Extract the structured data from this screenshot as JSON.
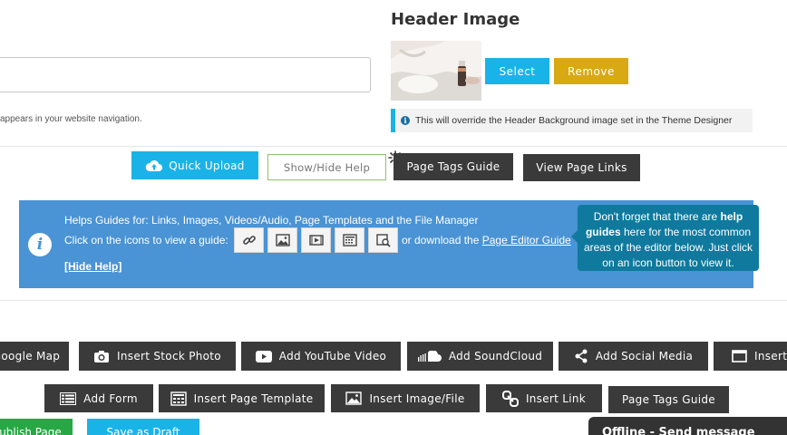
{
  "page_name": {
    "hint": "appears in your website navigation.",
    "input_value": ""
  },
  "header_image": {
    "title": "Header Image",
    "select_label": "Select",
    "remove_label": "Remove",
    "note": "This will override the Header Background image set in the Theme Designer"
  },
  "toolbar": {
    "quick_upload": "Quick Upload",
    "show_hide_help": "Show/Hide Help",
    "page_tags_guide": "Page Tags Guide",
    "view_page_links": "View Page Links"
  },
  "help": {
    "line1": "Helps Guides for: Links, Images, Videos/Audio, Page Templates and the File Manager",
    "line2": "Click on the icons to view a guide:",
    "download_prefix": "or download the",
    "download_link": "Page Editor Guide",
    "hide_help": "[Hide Help]",
    "guide_icons": [
      "link-icon",
      "image-icon",
      "video-icon",
      "template-icon",
      "file-manager-icon"
    ]
  },
  "tooltip": {
    "part1": "Don't forget that there are ",
    "bold": "help guides",
    "part2": " here for the most common areas of the editor below. Just click on an icon button to view it."
  },
  "insert_row1": [
    {
      "label": "Google Map",
      "icon": "map-icon"
    },
    {
      "label": "Insert Stock Photo",
      "icon": "camera-icon"
    },
    {
      "label": "Add YouTube Video",
      "icon": "youtube-icon"
    },
    {
      "label": "Add SoundCloud",
      "icon": "soundcloud-icon"
    },
    {
      "label": "Add Social Media",
      "icon": "share-icon"
    },
    {
      "label": "Insert",
      "icon": "window-icon"
    }
  ],
  "insert_row2": [
    {
      "label": "Add Form",
      "icon": "form-icon"
    },
    {
      "label": "Insert Page Template",
      "icon": "template-icon"
    },
    {
      "label": "Insert Image/File",
      "icon": "image-icon"
    },
    {
      "label": "Insert Link",
      "icon": "link-icon"
    },
    {
      "label": "Page Tags Guide",
      "icon": ""
    }
  ],
  "footer": {
    "publish": "Publish Page",
    "save_draft": "Save as Draft",
    "chat": "Offline - Send message"
  },
  "colors": {
    "accent_blue": "#1ab3e8",
    "remove_gold": "#d8a912",
    "help_panel": "#4a93d4",
    "tooltip": "#0f7a9e",
    "dark_button": "#3a3a3a",
    "publish_green": "#27a844"
  }
}
